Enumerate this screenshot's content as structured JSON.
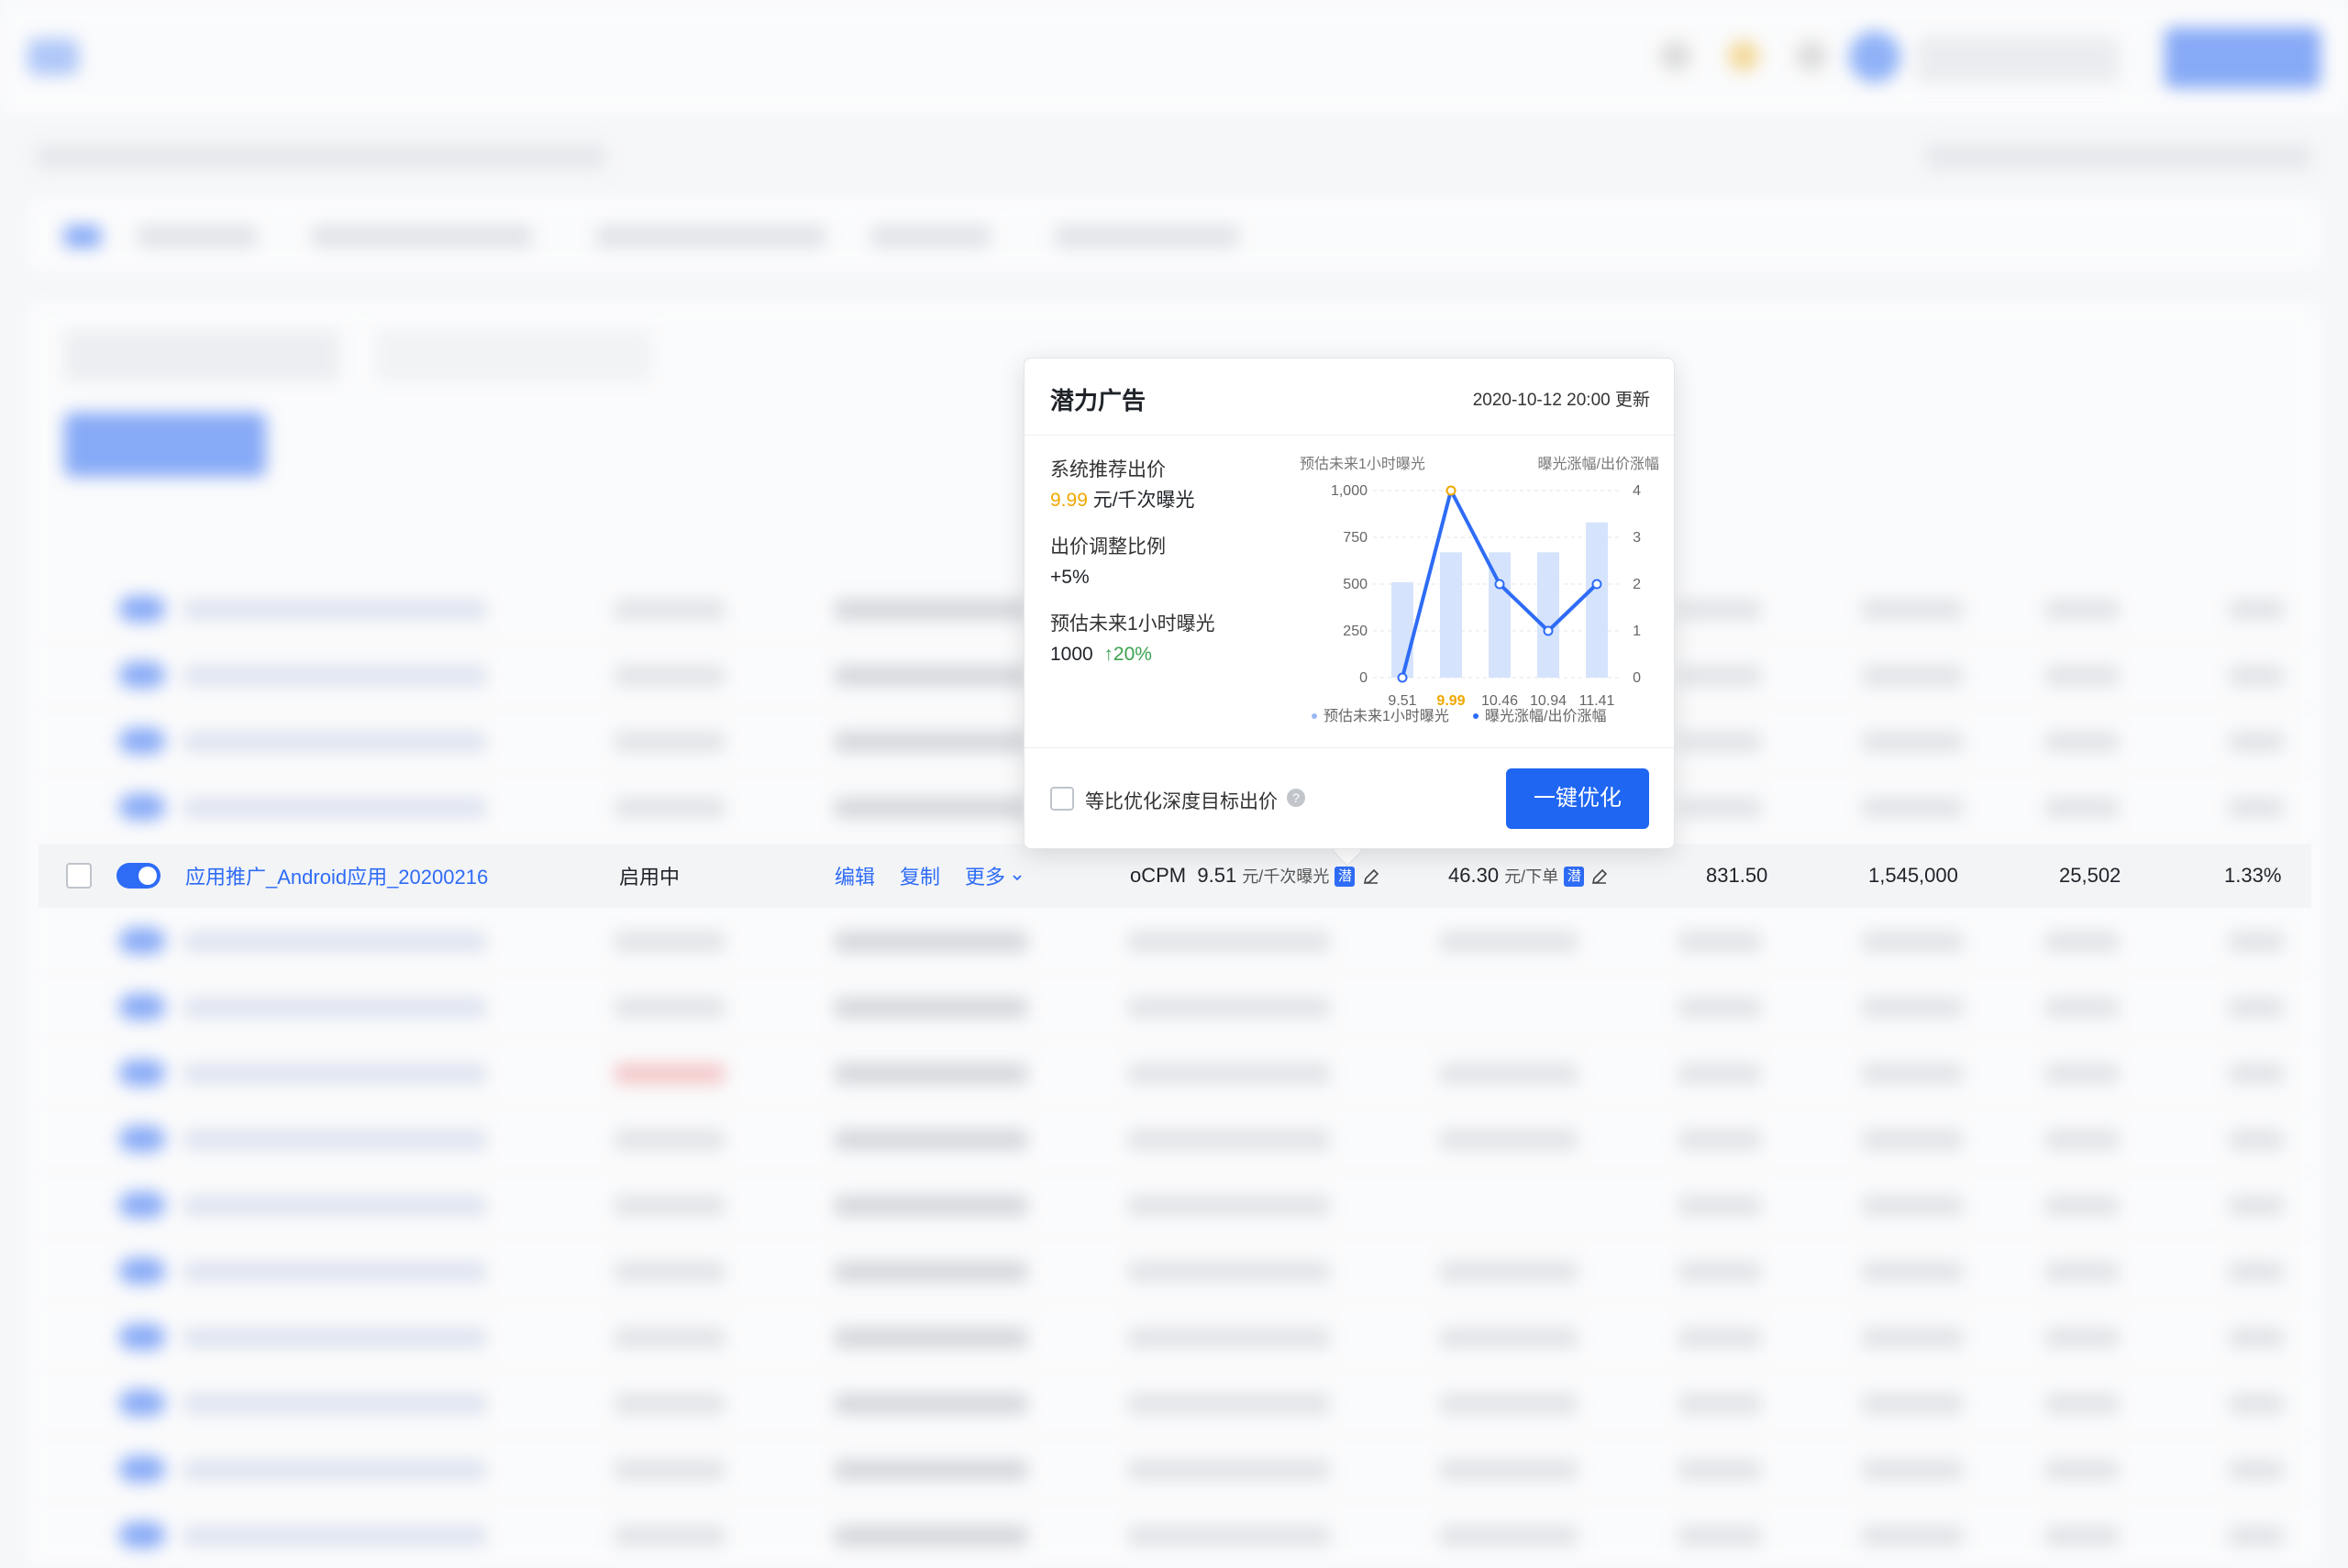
{
  "popover": {
    "title": "潜力广告",
    "updated": "2020-10-12 20:00 更新",
    "rec_bid_label": "系统推荐出价",
    "rec_bid_value": "9.99",
    "rec_bid_unit": " 元/千次曝光",
    "adjust_label": "出价调整比例",
    "adjust_value": "+5%",
    "forecast_label": "预估未来1小时曝光",
    "forecast_value": "1000",
    "forecast_change": "↑20%",
    "checkbox_label": "等比优化深度目标出价",
    "optimize_button": "一键优化"
  },
  "row": {
    "name": "应用推广_Android应用_20200216",
    "status": "启用中",
    "edit": "编辑",
    "copy": "复制",
    "more": "更多",
    "bid_type": "oCPM",
    "bid_value": "9.51",
    "bid_unit": "元/千次曝光",
    "tag": "潜",
    "cost_value": "46.30",
    "cost_unit": "元/下单",
    "v1": "831.50",
    "v2": "1,545,000",
    "v3": "25,502",
    "v4": "1.33%"
  },
  "chart_data": {
    "type": "bar",
    "categories": [
      "9.51",
      "9.99",
      "10.46",
      "10.94",
      "11.41"
    ],
    "highlight_category": "9.99",
    "series": [
      {
        "name": "预估未来1小时曝光",
        "type": "bar",
        "axis": "left",
        "values": [
          510,
          670,
          670,
          670,
          830
        ],
        "color": "#d6e3fc"
      },
      {
        "name": "曝光涨幅/出价涨幅",
        "type": "line",
        "axis": "right",
        "values": [
          0,
          4,
          2,
          1,
          2
        ],
        "color": "#2e6cf6"
      }
    ],
    "y_left_label": "预估未来1小时曝光",
    "y_right_label": "曝光涨幅/出价涨幅",
    "y_left_ticks": [
      "1,000",
      "750",
      "500",
      "250",
      "0"
    ],
    "y_right_ticks": [
      "4",
      "3",
      "2",
      "1",
      "0"
    ],
    "ylim_left": [
      0,
      1000
    ],
    "ylim_right": [
      0,
      4
    ],
    "legend": [
      "预估未来1小时曝光",
      "曝光涨幅/出价涨幅"
    ],
    "legend_position": "bottom",
    "grid": true
  }
}
